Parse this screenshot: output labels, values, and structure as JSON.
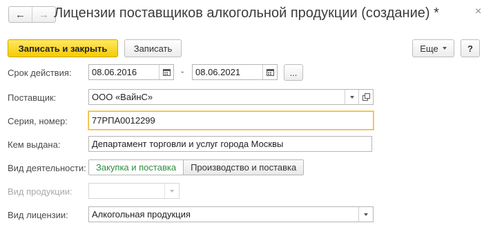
{
  "window": {
    "title": "Лицензии поставщиков алкогольной продукции (создание) *",
    "close_glyph": "×"
  },
  "nav": {
    "back_glyph": "←",
    "forward_glyph": "→"
  },
  "toolbar": {
    "save_close_label": "Записать и закрыть",
    "save_label": "Записать",
    "more_label": "Еще",
    "help_label": "?"
  },
  "form": {
    "validity": {
      "label": "Срок действия:",
      "date_from": "08.06.2016",
      "separator": "-",
      "date_to": "08.06.2021",
      "period_button": "..."
    },
    "supplier": {
      "label": "Поставщик:",
      "value": "ООО «ВайнС»"
    },
    "series_number": {
      "label": "Серия, номер:",
      "value": "77РПА0012299"
    },
    "issued_by": {
      "label": "Кем выдана:",
      "value": "Департамент торговли и услуг города Москвы"
    },
    "activity": {
      "label": "Вид деятельности:",
      "options": [
        "Закупка и поставка",
        "Производство и поставка"
      ],
      "selected": "Закупка и поставка"
    },
    "product_type": {
      "label": "Вид продукции:",
      "value": ""
    },
    "license_type": {
      "label": "Вид лицензии:",
      "value": "Алкогольная продукция"
    }
  },
  "colors": {
    "accent_yellow": "#f6cb00",
    "focus_border": "#f0b73f",
    "selected_option": "#2c8c3c"
  }
}
